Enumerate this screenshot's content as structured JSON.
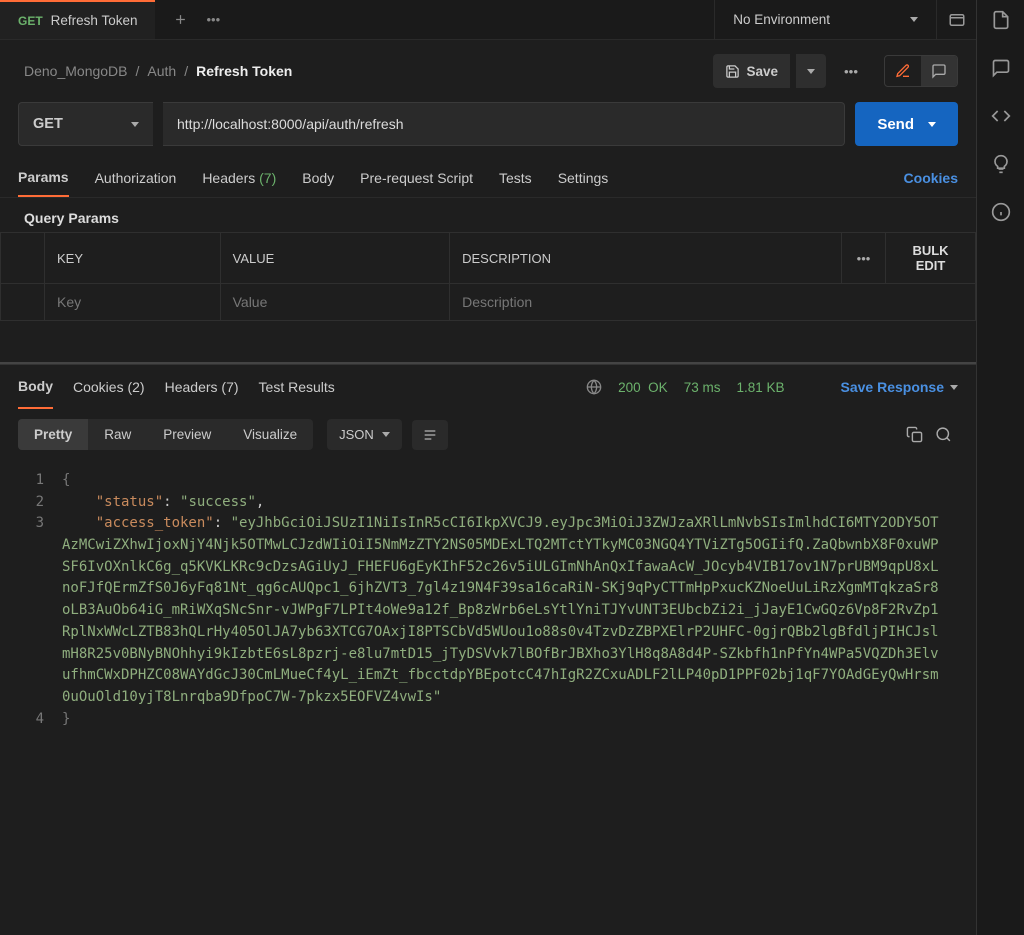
{
  "tab": {
    "method": "GET",
    "title": "Refresh Token"
  },
  "env": {
    "label": "No Environment"
  },
  "breadcrumbs": {
    "a": "Deno_MongoDB",
    "b": "Auth",
    "c": "Refresh Token"
  },
  "save_label": "Save",
  "method": "GET",
  "url": "http://localhost:8000/api/auth/refresh",
  "send_label": "Send",
  "reqtabs": {
    "params": "Params",
    "authorization": "Authorization",
    "headers": "Headers",
    "headers_count": "(7)",
    "body": "Body",
    "prerequest": "Pre-request Script",
    "tests": "Tests",
    "settings": "Settings",
    "cookies": "Cookies"
  },
  "qp_label": "Query Params",
  "table": {
    "key": "KEY",
    "value": "VALUE",
    "desc": "DESCRIPTION",
    "bulk": "Bulk Edit",
    "ph_key": "Key",
    "ph_value": "Value",
    "ph_desc": "Description"
  },
  "resptabs": {
    "body": "Body",
    "cookies": "Cookies",
    "cookies_count": "(2)",
    "headers": "Headers",
    "headers_count": "(7)",
    "tests": "Test Results"
  },
  "status": {
    "code": "200",
    "text": "OK",
    "time": "73 ms",
    "size": "1.81 KB"
  },
  "save_response": "Save Response",
  "view": {
    "pretty": "Pretty",
    "raw": "Raw",
    "preview": "Preview",
    "visualize": "Visualize",
    "format": "JSON"
  },
  "json": {
    "l1": "{",
    "l2_k": "\"status\"",
    "l2_v": "\"success\"",
    "l3_k": "\"access_token\"",
    "l3_v": "\"eyJhbGciOiJSUzI1NiIsInR5cCI6IkpXVCJ9.eyJpc3MiOiJ3ZWJzaXRlLmNvbSIsImlhdCI6MTY2ODY5OTAzMCwiZXhwIjoxNjY4Njk5OTMwLCJzdWIiOiI5NmMzZTY2NS05MDExLTQ2MTctYTkyMC03NGQ4YTViZTg5OGIifQ.ZaQbwnbX8F0xuWPSF6IvOXnlkC6g_q5KVKLKRc9cDzsAGiUyJ_FHEFU6gEyKIhF52c26v5iULGImNhAnQxIfawaAcW_JOcyb4VIB17ov1N7prUBM9qpU8xLnoFJfQErmZfS0J6yFq81Nt_qg6cAUQpc1_6jhZVT3_7gl4z19N4F39sa16caRiN-SKj9qPyCTTmHpPxucKZNoeUuLiRzXgmMTqkzaSr8oLB3AuOb64iG_mRiWXqSNcSnr-vJWPgF7LPIt4oWe9a12f_Bp8zWrb6eLsYtlYniTJYvUNT3EUbcbZi2i_jJayE1CwGQz6Vp8F2RvZp1RplNxWWcLZTB83hQLrHy405OlJA7yb63XTCG7OAxjI8PTSCbVd5WUou1o88s0v4TzvDzZBPXElrP2UHFC-0gjrQBb2lgBfdljPIHCJslmH8R25v0BNyBNOhhyi9kIzbtE6sL8pzrj-e8lu7mtD15_jTyDSVvk7lBOfBrJBXho3YlH8q8A8d4P-SZkbfh1nPfYn4WPa5VQZDh3ElvufhmCWxDPHZC08WAYdGcJ30CmLMueCf4yL_iEmZt_fbcctdpYBEpotcC47hIgR2ZCxuADLF2lLP40pD1PPF02bj1qF7YOAdGEyQwHrsm0uOuOld10yjT8Lnrqba9DfpoC7W-7pkzx5EOFVZ4vwIs\"",
    "l4": "}"
  }
}
